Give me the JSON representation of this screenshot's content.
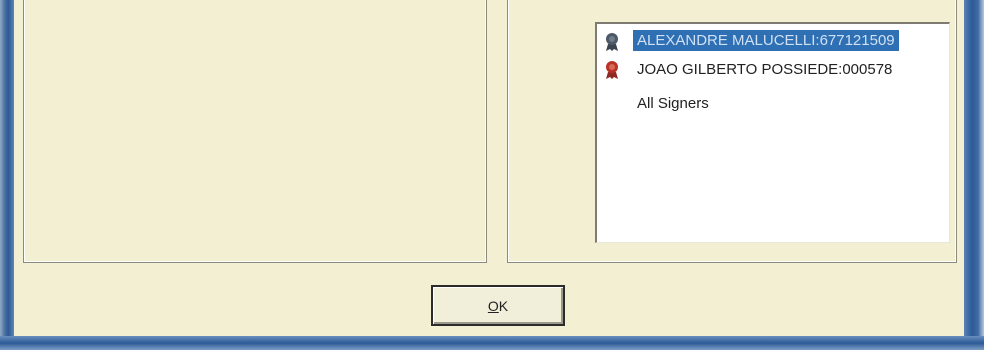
{
  "signers": [
    {
      "label": "ALEXANDRE MALUCELLI:677121509",
      "selected": true,
      "icon": "certificate-ribbon-icon",
      "icon_color": "#4d5866"
    },
    {
      "label": "JOAO GILBERTO POSSIEDE:000578",
      "selected": false,
      "icon": "certificate-ribbon-icon",
      "icon_color": "#b83228"
    },
    {
      "label": "All Signers",
      "selected": false,
      "icon": null
    }
  ],
  "buttons": {
    "ok_prefix": "O",
    "ok_rest": "K"
  },
  "colors": {
    "dialog_bg": "#f3efd2",
    "selection": "#2f6fb3",
    "frame": "#2d5a94"
  }
}
